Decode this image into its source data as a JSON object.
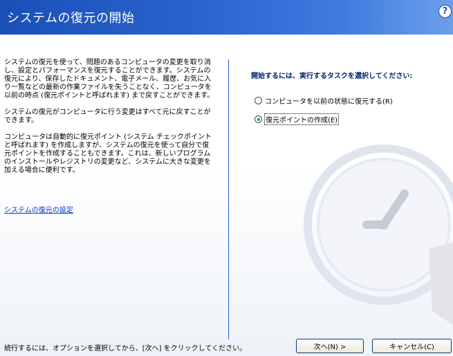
{
  "header": {
    "title": "システムの復元の開始"
  },
  "left": {
    "paragraphs": [
      "システムの復元を使って、問題のあるコンピュータの変更を取り消し、設定とパフォーマンスを復元することができます。システムの復元により、保存したドキュメント、電子メール、履歴、お気に入り一覧などの最新の作業ファイルを失うことなく、コンピュータを以前の時点 (復元ポイントと呼ばれます) まで戻すことができます。",
      "システムの復元がコンピュータに行う変更はすべて元に戻すことができます。",
      "コンピュータは自動的に復元ポイント (システム チェックポイントと呼ばれます) を作成しますが、システムの復元を使って自分で復元ポイントを作成することもできます。これは、新しいプログラムのインストールやレジストリの変更など、システムに大きな変更を加える場合に便利です。"
    ],
    "settings_link": "システムの復元の設定"
  },
  "right": {
    "prompt": "開始するには、実行するタスクを選択してください:",
    "options": [
      {
        "label": "コンピュータを以前の状態に復元する(R)",
        "checked": false
      },
      {
        "label": "復元ポイントの作成(E)",
        "checked": true
      }
    ]
  },
  "footer": {
    "instruction": "続行するには、オプションを選択してから、[次へ] をクリックしてください。",
    "next_label": "次へ(N) >",
    "cancel_label": "キャンセル(C)"
  }
}
